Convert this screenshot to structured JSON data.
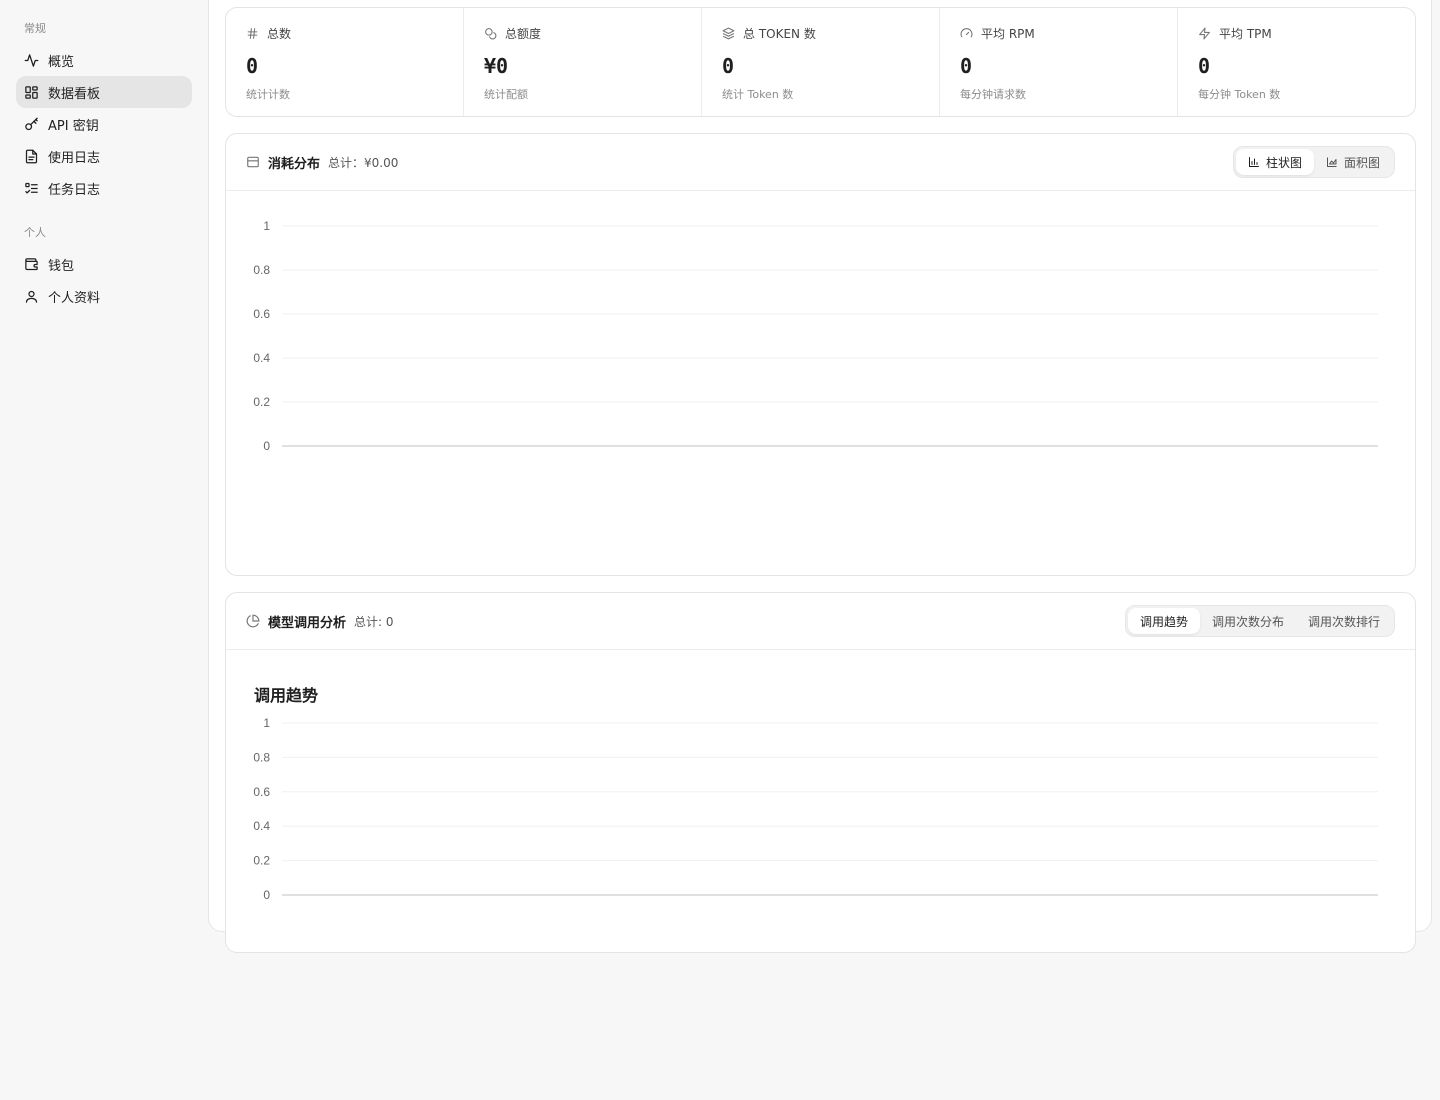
{
  "sidebar": {
    "groups": [
      {
        "label": "常规",
        "items": [
          {
            "label": "概览",
            "icon": "activity-icon"
          },
          {
            "label": "数据看板",
            "icon": "dashboard-grid-icon"
          },
          {
            "label": "API 密钥",
            "icon": "key-icon"
          },
          {
            "label": "使用日志",
            "icon": "document-icon"
          },
          {
            "label": "任务日志",
            "icon": "list-check-icon"
          }
        ]
      },
      {
        "label": "个人",
        "items": [
          {
            "label": "钱包",
            "icon": "wallet-icon"
          },
          {
            "label": "个人资料",
            "icon": "user-icon"
          }
        ]
      }
    ],
    "active_item": "数据看板"
  },
  "stats": [
    {
      "label": "总数",
      "value": "0",
      "sub": "统计计数",
      "icon": "hash-icon"
    },
    {
      "label": "总额度",
      "value": "¥0",
      "sub": "统计配额",
      "icon": "coins-icon"
    },
    {
      "label": "总 TOKEN 数",
      "value": "0",
      "sub": "统计 Token 数",
      "icon": "layers-icon"
    },
    {
      "label": "平均 RPM",
      "value": "0",
      "sub": "每分钟请求数",
      "icon": "gauge-icon"
    },
    {
      "label": "平均 TPM",
      "value": "0",
      "sub": "每分钟 Token 数",
      "icon": "zap-icon"
    }
  ],
  "consumption": {
    "title": "消耗分布",
    "total": "总计：¥0.00",
    "icon": "wallet-card-icon",
    "toggles": [
      {
        "label": "柱状图",
        "icon": "bar-chart-icon"
      },
      {
        "label": "面积图",
        "icon": "area-chart-icon"
      }
    ],
    "active_toggle": "柱状图"
  },
  "analysis": {
    "title": "模型调用分析",
    "total": "总计:  0",
    "icon": "pie-chart-icon",
    "tabs": [
      "调用趋势",
      "调用次数分布",
      "调用次数排行"
    ],
    "active_tab": "调用趋势",
    "chart_title": "调用趋势"
  },
  "chart_data": [
    {
      "type": "bar",
      "title": "",
      "categories": [],
      "values": [],
      "yticks": [
        "1",
        "0.8",
        "0.6",
        "0.4",
        "0.2",
        "0"
      ],
      "ylim": [
        0,
        1
      ],
      "grid": true
    },
    {
      "type": "line",
      "title": "调用趋势",
      "x": [],
      "values": [],
      "yticks": [
        "1",
        "0.8",
        "0.6",
        "0.4",
        "0.2",
        "0"
      ],
      "ylim": [
        0,
        1
      ],
      "grid": true
    }
  ],
  "colors": {
    "accent": "#1f1f1f",
    "active_bg": "#e5e5e5",
    "grid": "#f0f0f0",
    "axis": "#d6d6d6"
  }
}
